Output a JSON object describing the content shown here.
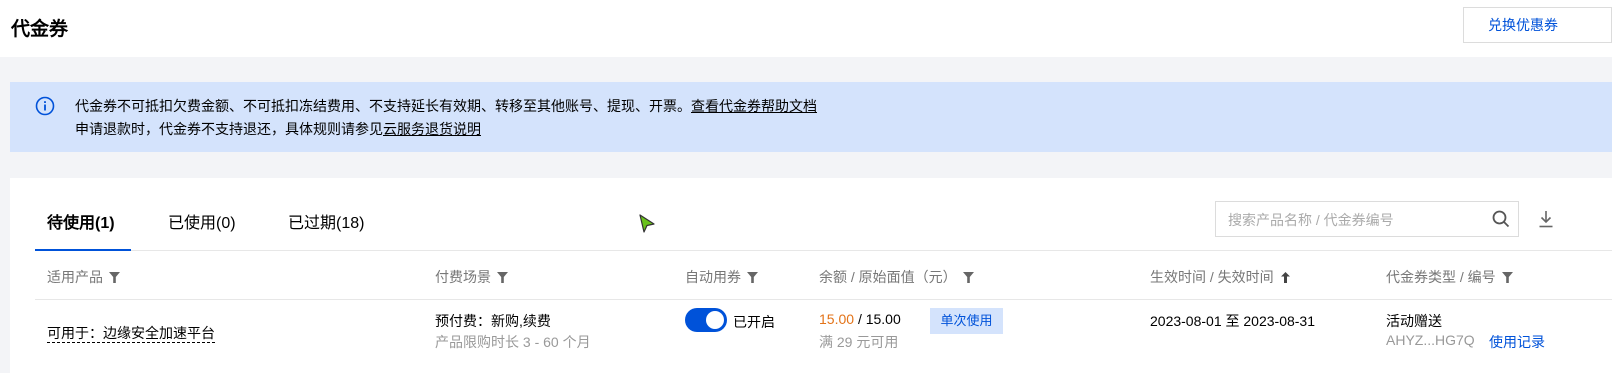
{
  "header": {
    "title": "代金券",
    "redeem_button": "兑换优惠券"
  },
  "notice": {
    "line1_text": "代金券不可抵扣欠费金额、不可抵扣冻结费用、不支持延长有效期、转移至其他账号、提现、开票。",
    "line1_link": "查看代金券帮助文档",
    "line2_text": "申请退款时，代金券不支持退还，具体规则请参见",
    "line2_link": "云服务退货说明"
  },
  "tabs": [
    {
      "label": "待使用(1)",
      "active": true
    },
    {
      "label": "已使用(0)",
      "active": false
    },
    {
      "label": "已过期(18)",
      "active": false
    }
  ],
  "search": {
    "placeholder": "搜索产品名称 / 代金券编号"
  },
  "columns": {
    "product": "适用产品",
    "scene": "付费场景",
    "auto_use": "自动用券",
    "amount": "余额 / 原始面值（元）",
    "time": "生效时间 / 失效时间",
    "type": "代金券类型 / 编号"
  },
  "row": {
    "product": "可用于：边缘安全加速平台",
    "scene": "预付费：新购,续费",
    "scene_limit": "产品限购时长 3 - 60 个月",
    "auto_use_status": "已开启",
    "balance": "15.00",
    "slash_original": "/ 15.00",
    "condition": "满 29 元可用",
    "usage_badge": "单次使用",
    "period": "2023-08-01 至 2023-08-31",
    "type": "活动赠送",
    "code": "AHYZ...HG7Q",
    "record_link": "使用记录"
  },
  "colors": {
    "primary": "#0052d9",
    "orange": "#e37318",
    "notice_bg": "#d4e3fc"
  }
}
